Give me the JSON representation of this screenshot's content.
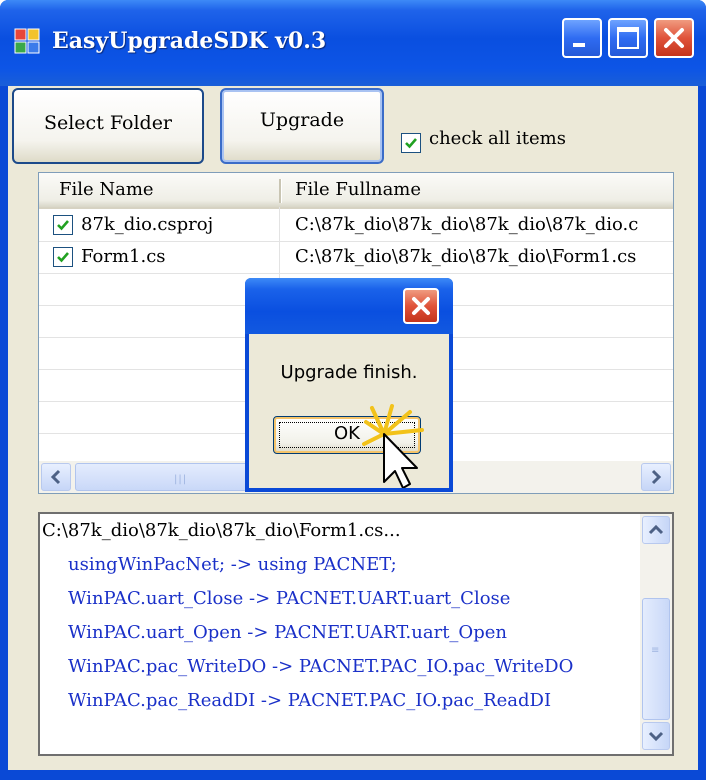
{
  "window": {
    "title": "EasyUpgradeSDK v0.3",
    "icons": {
      "app": "app-window-icon",
      "minimize": "minimize-icon",
      "maximize": "maximize-icon",
      "close": "close-icon"
    }
  },
  "toolbar": {
    "select_folder_label": "Select Folder",
    "upgrade_label": "Upgrade",
    "check_all_label": "check all items",
    "check_all_checked": true
  },
  "file_list": {
    "columns": [
      "File Name",
      "File Fullname"
    ],
    "rows": [
      {
        "checked": true,
        "name": "87k_dio.csproj",
        "fullname": "C:\\87k_dio\\87k_dio\\87k_dio\\87k_dio.c"
      },
      {
        "checked": true,
        "name": "Form1.cs",
        "fullname": "C:\\87k_dio\\87k_dio\\87k_dio\\Form1.cs"
      }
    ]
  },
  "log": {
    "path_line": "C:\\87k_dio\\87k_dio\\87k_dio\\Form1.cs...",
    "lines": [
      "usingWinPacNet; -> using PACNET;",
      "WinPAC.uart_Close -> PACNET.UART.uart_Close",
      "WinPAC.uart_Open -> PACNET.UART.uart_Open",
      "WinPAC.pac_WriteDO -> PACNET.PAC_IO.pac_WriteDO",
      "WinPAC.pac_ReadDI -> PACNET.PAC_IO.pac_ReadDI"
    ],
    "line_color": "#1a30c8"
  },
  "dialog": {
    "message": "Upgrade finish.",
    "ok_label": "OK"
  },
  "scrollbar": {
    "grip_h": "|||",
    "grip_v": "≡"
  }
}
